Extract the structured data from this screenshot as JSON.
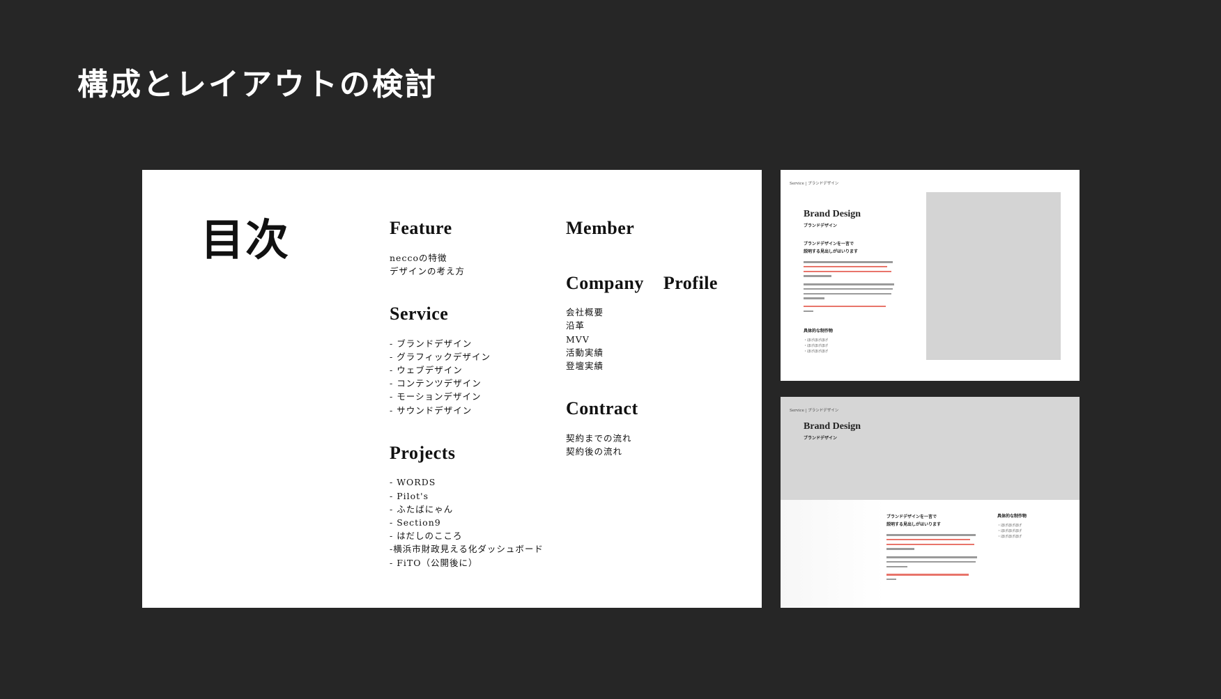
{
  "page": {
    "title": "構成とレイアウトの検討"
  },
  "toc": {
    "title": "目次",
    "sections": {
      "feature": {
        "heading": "Feature",
        "items": [
          "neccoの特徴",
          "デザインの考え方"
        ]
      },
      "service": {
        "heading": "Service",
        "items": [
          "- ブランドデザイン",
          "- グラフィックデザイン",
          "- ウェブデザイン",
          "- コンテンツデザイン",
          "- モーションデザイン",
          "- サウンドデザイン"
        ]
      },
      "projects": {
        "heading": "Projects",
        "items": [
          "- WORDS",
          "- Pilot's",
          "- ふたばにゃん",
          "- Section9",
          "- はだしのこころ",
          "-横浜市財政見える化ダッシュボード",
          "- FiTO（公開後に）"
        ]
      },
      "member": {
        "heading": "Member",
        "items": []
      },
      "company_profile": {
        "heading": "Company    Profile",
        "items": [
          "会社概要",
          "沿革",
          "MVV",
          "活動実績",
          "登壇実績"
        ]
      },
      "contract": {
        "heading": "Contract",
        "items": [
          "契約までの流れ",
          "契約後の流れ"
        ]
      }
    }
  },
  "thumbnails": [
    {
      "breadcrumb": "Service | ブランドデザイン",
      "heading": "Brand Design",
      "subheading": "ブランドデザイン",
      "lead": "ブランドデザインを一言で\n説明する見出しがはいります",
      "works_title": "具体的な制作物",
      "works_items": [
        "・ほげほげほげ",
        "・ほげほげほげ",
        "・ほげほげほげ"
      ]
    },
    {
      "breadcrumb": "Service | ブランドデザイン",
      "heading": "Brand Design",
      "subheading": "ブランドデザイン",
      "lead": "ブランドデザインを一言で\n説明する見出しがはいります",
      "works_title": "具体的な制作物",
      "works_items": [
        "・ほげほげほげ",
        "・ほげほげほげ",
        "・ほげほげほげ"
      ]
    }
  ],
  "colors": {
    "background": "#262626",
    "slide": "#ffffff",
    "placeholder_gray": "#d4d4d4",
    "accent_red": "#e8746a"
  }
}
